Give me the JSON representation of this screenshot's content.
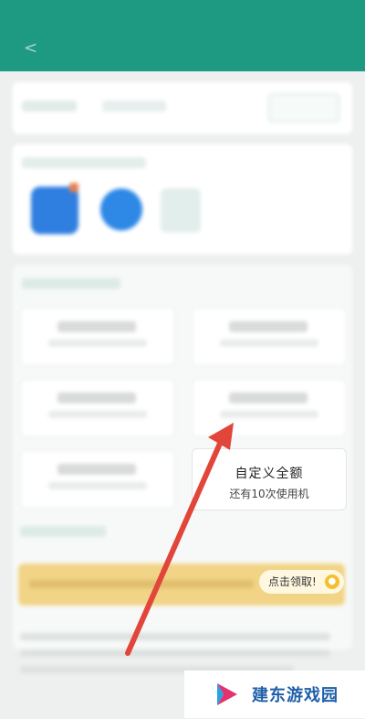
{
  "custom_amount": {
    "title": "自定义全额",
    "subtitle": "还有10次使用机"
  },
  "banner": {
    "claim_label": "点击领取!"
  },
  "watermark": {
    "text": "建东游戏园"
  },
  "colors": {
    "primary": "#1f9a82",
    "banner": "#f2d486",
    "arrow": "#e2463b",
    "watermark_blue": "#1f5fa8"
  }
}
